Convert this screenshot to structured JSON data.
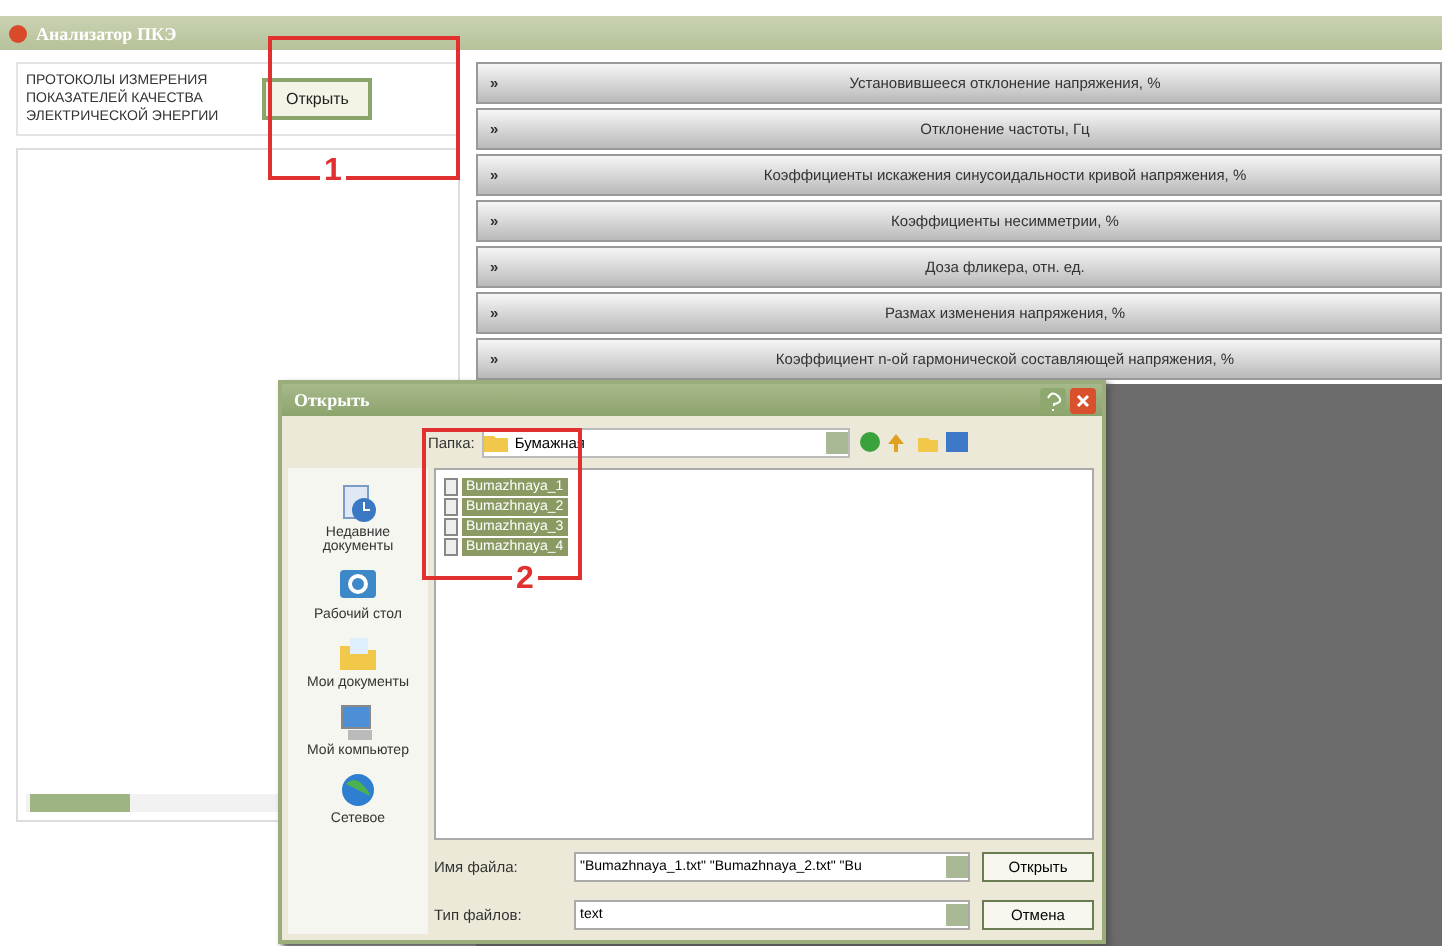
{
  "window": {
    "title": "Анализатор ПКЭ"
  },
  "left_panel": {
    "heading": "ПРОТОКОЛЫ ИЗМЕРЕНИЯ ПОКАЗАТЕЛЕЙ КАЧЕСТВА ЭЛЕКТРИЧЕСКОЙ ЭНЕРГИИ",
    "open_button": "Открыть"
  },
  "sections": [
    {
      "marker": "»",
      "label": "Установившееся отклонение напряжения, %"
    },
    {
      "marker": "»",
      "label": "Отклонение частоты, Гц"
    },
    {
      "marker": "»",
      "label": "Коэффициенты искажения синусоидальности кривой напряжения, %"
    },
    {
      "marker": "»",
      "label": "Коэффициенты несимметрии, %"
    },
    {
      "marker": "»",
      "label": "Доза фликера, отн. ед."
    },
    {
      "marker": "»",
      "label": "Размах изменения напряжения, %"
    },
    {
      "marker": "»",
      "label": "Коэффициент n-ой гармонической составляющей напряжения, %"
    }
  ],
  "dialog": {
    "title": "Открыть",
    "folder_label": "Папка:",
    "folder": "Бумажная",
    "places": [
      {
        "kind": "recent",
        "label": "Недавние документы"
      },
      {
        "kind": "desktop",
        "label": "Рабочий стол"
      },
      {
        "kind": "documents",
        "label": "Мои документы"
      },
      {
        "kind": "computer",
        "label": "Мой компьютер"
      },
      {
        "kind": "network",
        "label": "Сетевое"
      }
    ],
    "files": [
      {
        "name": "Bumazhnaya_1",
        "selected": true
      },
      {
        "name": "Bumazhnaya_2",
        "selected": true
      },
      {
        "name": "Bumazhnaya_3",
        "selected": true
      },
      {
        "name": "Bumazhnaya_4",
        "selected": true
      }
    ],
    "filename_label": "Имя файла:",
    "filename": "\"Bumazhnaya_1.txt\" \"Bumazhnaya_2.txt\" \"Bu",
    "filetype_label": "Тип файлов:",
    "filetype": "text",
    "open_button": "Открыть",
    "cancel_button": "Отмена"
  },
  "annotations": [
    {
      "number": "1"
    },
    {
      "number": "2"
    }
  ]
}
